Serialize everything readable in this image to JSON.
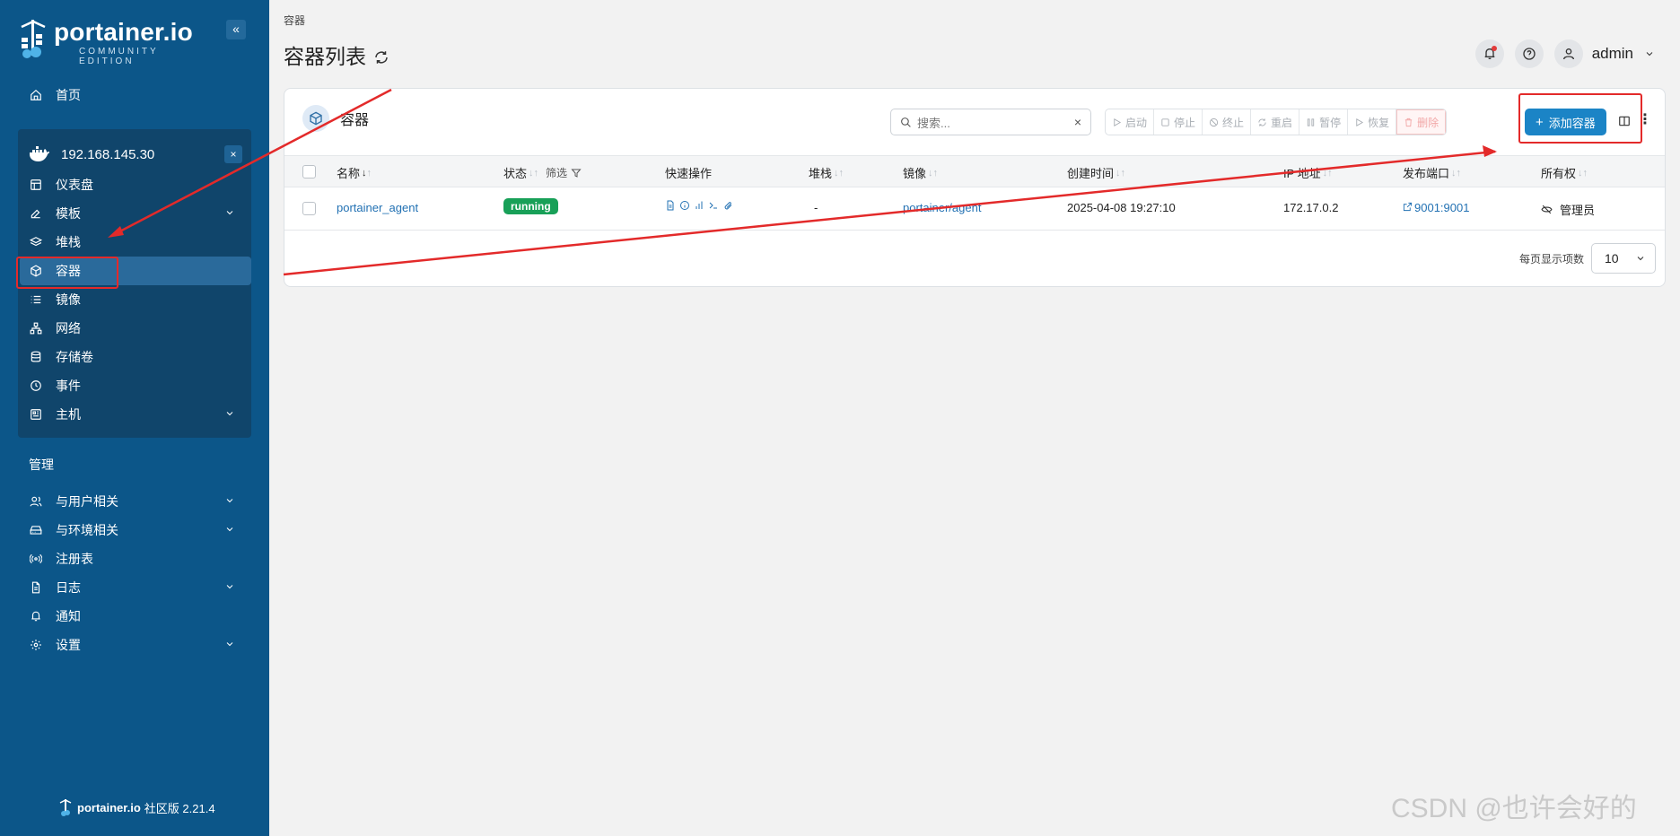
{
  "sidebar": {
    "brand": "portainer.io",
    "edition": "COMMUNITY EDITION",
    "collapse_glyph": "«",
    "home": "首页",
    "environment": {
      "name": "192.168.145.30",
      "close_glyph": "×",
      "items": [
        {
          "label": "仪表盘",
          "icon": "dashboard-icon"
        },
        {
          "label": "模板",
          "icon": "edit-icon",
          "expandable": true
        },
        {
          "label": "堆栈",
          "icon": "layers-icon"
        },
        {
          "label": "容器",
          "icon": "box-icon",
          "active": true
        },
        {
          "label": "镜像",
          "icon": "list-icon"
        },
        {
          "label": "网络",
          "icon": "network-icon"
        },
        {
          "label": "存储卷",
          "icon": "database-icon"
        },
        {
          "label": "事件",
          "icon": "clock-icon"
        },
        {
          "label": "主机",
          "icon": "host-icon",
          "expandable": true
        }
      ]
    },
    "admin_title": "管理",
    "admin_items": [
      {
        "label": "与用户相关",
        "icon": "users-icon",
        "expandable": true
      },
      {
        "label": "与环境相关",
        "icon": "drive-icon",
        "expandable": true
      },
      {
        "label": "注册表",
        "icon": "radio-icon"
      },
      {
        "label": "日志",
        "icon": "file-icon",
        "expandable": true
      },
      {
        "label": "通知",
        "icon": "bell-icon"
      },
      {
        "label": "设置",
        "icon": "gear-icon",
        "expandable": true
      }
    ],
    "footer_brand": "portainer.io",
    "footer_version": "社区版 2.21.4"
  },
  "header": {
    "breadcrumb": "容器",
    "title": "容器列表",
    "user": "admin"
  },
  "card": {
    "title": "容器",
    "search_placeholder": "搜索...",
    "actions": {
      "start": "启动",
      "stop": "停止",
      "kill": "终止",
      "restart": "重启",
      "pause": "暂停",
      "resume": "恢复",
      "remove": "删除"
    },
    "add_button": "添加容器",
    "columns": {
      "name": "名称",
      "state": "状态",
      "filter": "筛选",
      "quick_actions": "快速操作",
      "stack": "堆栈",
      "image": "镜像",
      "created": "创建时间",
      "ip": "IP 地址",
      "ports": "发布端口",
      "ownership": "所有权"
    },
    "rows": [
      {
        "name": "portainer_agent",
        "state": "running",
        "stack": "-",
        "image": "portainer/agent",
        "created": "2025-04-08 19:27:10",
        "ip": "172.17.0.2",
        "ports": "9001:9001",
        "ownership": "管理员"
      }
    ],
    "page_size_label": "每页显示项数",
    "page_size": "10"
  },
  "watermark": "CSDN @也许会好的",
  "colors": {
    "sidebar": "#0c5689",
    "primary": "#1b84c6",
    "running": "#18a058",
    "annotation": "#e32a2a"
  }
}
